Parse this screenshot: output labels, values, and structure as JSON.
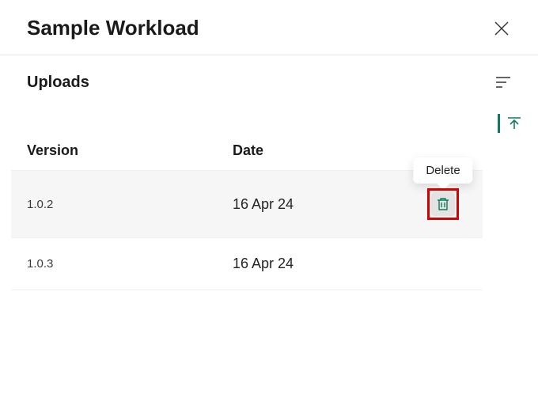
{
  "header": {
    "title": "Sample Workload"
  },
  "section": {
    "title": "Uploads"
  },
  "table": {
    "columns": {
      "version": "Version",
      "date": "Date"
    },
    "rows": [
      {
        "version": "1.0.2",
        "date": "16 Apr 24",
        "highlighted": true
      },
      {
        "version": "1.0.3",
        "date": "16 Apr 24",
        "highlighted": false
      }
    ]
  },
  "tooltip": {
    "delete": "Delete"
  },
  "colors": {
    "accent": "#0f7b5f",
    "annotation": "#d40000"
  }
}
